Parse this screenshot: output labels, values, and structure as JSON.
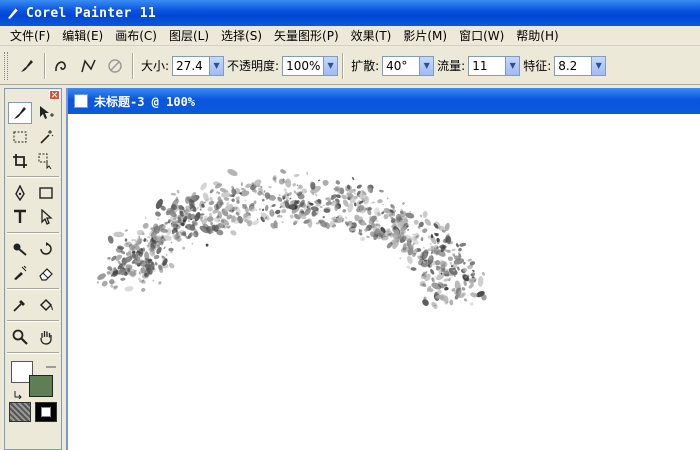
{
  "app": {
    "title": "Corel Painter 11"
  },
  "menu": [
    "文件(F)",
    "编辑(E)",
    "画布(C)",
    "图层(L)",
    "选择(S)",
    "矢量图形(P)",
    "效果(T)",
    "影片(M)",
    "窗口(W)",
    "帮助(H)"
  ],
  "props": {
    "size_label": "大小:",
    "size_value": "27.4",
    "opacity_label": "不透明度:",
    "opacity_value": "100%",
    "spread_label": "扩散:",
    "spread_value": "40°",
    "flow_label": "流量:",
    "flow_value": "11",
    "feature_label": "特征:",
    "feature_value": "8.2"
  },
  "document": {
    "title": "未标题-3 @ 100%"
  },
  "colors": {
    "main": "#ffffff",
    "additional": "#5e7f56"
  }
}
